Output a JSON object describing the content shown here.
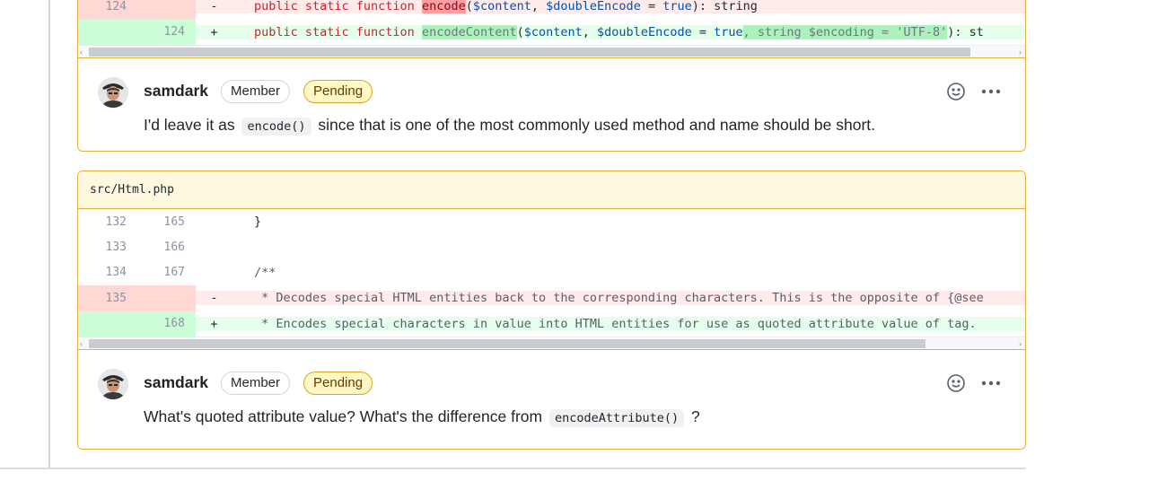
{
  "card1": {
    "diff_rows": [
      {
        "type": "del",
        "old": "124",
        "new": "",
        "sign": "-",
        "parts": [
          {
            "t": "public static function ",
            "c": "kw"
          },
          {
            "t": "encode",
            "c": "hl-del"
          },
          {
            "t": "(",
            "c": "fn"
          },
          {
            "t": "$content",
            "c": "var"
          },
          {
            "t": ", ",
            "c": "fn"
          },
          {
            "t": "$doubleEncode",
            "c": "var"
          },
          {
            "t": " = ",
            "c": "fn"
          },
          {
            "t": "true",
            "c": "var"
          },
          {
            "t": "): string",
            "c": "fn"
          }
        ]
      },
      {
        "type": "add",
        "old": "",
        "new": "124",
        "sign": "+",
        "parts": [
          {
            "t": "public static function ",
            "c": "kw"
          },
          {
            "t": "encodeContent",
            "c": "hl-add"
          },
          {
            "t": "(",
            "c": "fn"
          },
          {
            "t": "$content",
            "c": "var"
          },
          {
            "t": ", ",
            "c": "fn"
          },
          {
            "t": "$doubleEncode",
            "c": "var"
          },
          {
            "t": " = ",
            "c": "fn"
          },
          {
            "t": "true",
            "c": "var"
          },
          {
            "t": ", string $encoding = 'UTF-8'",
            "c": "hl-add"
          },
          {
            "t": "): st",
            "c": "fn"
          }
        ]
      }
    ],
    "comment": {
      "author": "samdark",
      "member_badge": "Member",
      "pending_badge": "Pending",
      "text_before": "I'd leave it as",
      "code": "encode()",
      "text_after": "since that is one of the most commonly used method and name should be short."
    }
  },
  "card2": {
    "file_path": "src/Html.php",
    "diff_rows": [
      {
        "type": "ctx",
        "old": "132",
        "new": "165",
        "sign": "",
        "parts": [
          {
            "t": "}",
            "c": "fn"
          }
        ]
      },
      {
        "type": "ctx",
        "old": "133",
        "new": "166",
        "sign": "",
        "parts": [
          {
            "t": "",
            "c": "fn"
          }
        ]
      },
      {
        "type": "ctx",
        "old": "134",
        "new": "167",
        "sign": "",
        "parts": [
          {
            "t": "/**",
            "c": "cm"
          }
        ]
      },
      {
        "type": "del",
        "old": "135",
        "new": "",
        "sign": "-",
        "parts": [
          {
            "t": " * Decodes special HTML entities back to the corresponding characters. This is the opposite of {@see",
            "c": "cm"
          }
        ]
      },
      {
        "type": "add",
        "old": "",
        "new": "168",
        "sign": "+",
        "parts": [
          {
            "t": " * Encodes special characters in value into HTML entities for use as quoted attribute value of tag.",
            "c": "cm"
          }
        ]
      }
    ],
    "comment": {
      "author": "samdark",
      "member_badge": "Member",
      "pending_badge": "Pending",
      "text_before": "What's quoted attribute value? What's the difference from",
      "code": "encodeAttribute()",
      "text_after": "?"
    }
  },
  "icons": {
    "reaction": "smiley-icon",
    "more": "kebab-icon",
    "avatar": "user-avatar"
  }
}
